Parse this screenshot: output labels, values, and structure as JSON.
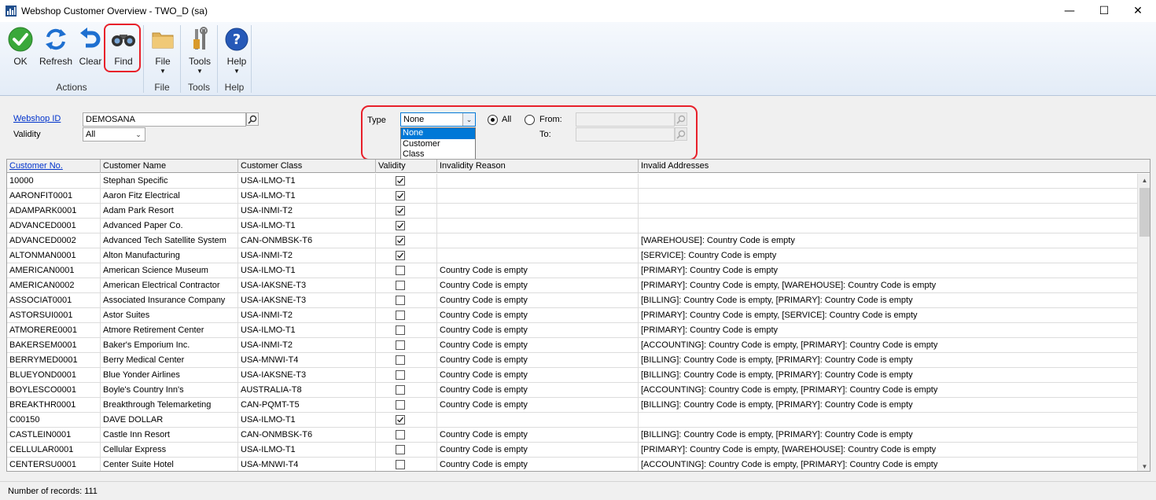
{
  "window": {
    "title": "Webshop Customer Overview  -  TWO_D (sa)",
    "minimize": "—",
    "maximize": "☐",
    "close": "✕"
  },
  "ribbon": {
    "buttons": {
      "ok": "OK",
      "refresh": "Refresh",
      "clear": "Clear",
      "find": "Find",
      "file": "File",
      "tools": "Tools",
      "help": "Help"
    },
    "groups": {
      "actions": "Actions",
      "file": "File",
      "tools": "Tools",
      "help": "Help"
    }
  },
  "form": {
    "webshop_id_label": "Webshop ID",
    "webshop_id_value": "DEMOSANA",
    "validity_label": "Validity",
    "validity_value": "All",
    "type_label": "Type",
    "type_value": "None",
    "type_options": [
      "None",
      "Customer",
      "Class"
    ],
    "all_label": "All",
    "from_label": "From:",
    "to_label": "To:",
    "all_selected": true
  },
  "grid": {
    "headers": [
      "Customer No.",
      "Customer Name",
      "Customer Class",
      "Validity",
      "Invalidity Reason",
      "Invalid Addresses"
    ],
    "rows": [
      {
        "no": "10000",
        "name": "Stephan Specific",
        "cls": "USA-ILMO-T1",
        "valid": true,
        "reason": "",
        "addr": ""
      },
      {
        "no": "AARONFIT0001",
        "name": "Aaron Fitz Electrical",
        "cls": "USA-ILMO-T1",
        "valid": true,
        "reason": "",
        "addr": ""
      },
      {
        "no": "ADAMPARK0001",
        "name": "Adam Park Resort",
        "cls": "USA-INMI-T2",
        "valid": true,
        "reason": "",
        "addr": ""
      },
      {
        "no": "ADVANCED0001",
        "name": "Advanced Paper Co.",
        "cls": "USA-ILMO-T1",
        "valid": true,
        "reason": "",
        "addr": ""
      },
      {
        "no": "ADVANCED0002",
        "name": "Advanced Tech Satellite System",
        "cls": "CAN-ONMBSK-T6",
        "valid": true,
        "reason": "",
        "addr": "[WAREHOUSE]: Country Code is empty"
      },
      {
        "no": "ALTONMAN0001",
        "name": "Alton Manufacturing",
        "cls": "USA-INMI-T2",
        "valid": true,
        "reason": "",
        "addr": "[SERVICE]: Country Code is empty"
      },
      {
        "no": "AMERICAN0001",
        "name": "American Science Museum",
        "cls": "USA-ILMO-T1",
        "valid": false,
        "reason": "Country Code is empty",
        "addr": "[PRIMARY]: Country Code is empty"
      },
      {
        "no": "AMERICAN0002",
        "name": "American Electrical Contractor",
        "cls": "USA-IAKSNE-T3",
        "valid": false,
        "reason": "Country Code is empty",
        "addr": "[PRIMARY]: Country Code is empty, [WAREHOUSE]: Country Code is empty"
      },
      {
        "no": "ASSOCIAT0001",
        "name": "Associated Insurance Company",
        "cls": "USA-IAKSNE-T3",
        "valid": false,
        "reason": "Country Code is empty",
        "addr": "[BILLING]: Country Code is empty, [PRIMARY]: Country Code is empty"
      },
      {
        "no": "ASTORSUI0001",
        "name": "Astor Suites",
        "cls": "USA-INMI-T2",
        "valid": false,
        "reason": "Country Code is empty",
        "addr": "[PRIMARY]: Country Code is empty, [SERVICE]: Country Code is empty"
      },
      {
        "no": "ATMORERE0001",
        "name": "Atmore Retirement Center",
        "cls": "USA-ILMO-T1",
        "valid": false,
        "reason": "Country Code is empty",
        "addr": "[PRIMARY]: Country Code is empty"
      },
      {
        "no": "BAKERSEM0001",
        "name": "Baker's Emporium Inc.",
        "cls": "USA-INMI-T2",
        "valid": false,
        "reason": "Country Code is empty",
        "addr": "[ACCOUNTING]: Country Code is empty, [PRIMARY]: Country Code is empty"
      },
      {
        "no": "BERRYMED0001",
        "name": "Berry Medical Center",
        "cls": "USA-MNWI-T4",
        "valid": false,
        "reason": "Country Code is empty",
        "addr": "[BILLING]: Country Code is empty, [PRIMARY]: Country Code is empty"
      },
      {
        "no": "BLUEYOND0001",
        "name": "Blue Yonder Airlines",
        "cls": "USA-IAKSNE-T3",
        "valid": false,
        "reason": "Country Code is empty",
        "addr": "[BILLING]: Country Code is empty, [PRIMARY]: Country Code is empty"
      },
      {
        "no": "BOYLESCO0001",
        "name": "Boyle's Country Inn's",
        "cls": "AUSTRALIA-T8",
        "valid": false,
        "reason": "Country Code is empty",
        "addr": "[ACCOUNTING]: Country Code is empty, [PRIMARY]: Country Code is empty"
      },
      {
        "no": "BREAKTHR0001",
        "name": "Breakthrough Telemarketing",
        "cls": "CAN-PQMT-T5",
        "valid": false,
        "reason": "Country Code is empty",
        "addr": "[BILLING]: Country Code is empty, [PRIMARY]: Country Code is empty"
      },
      {
        "no": "C00150",
        "name": "DAVE DOLLAR",
        "cls": "USA-ILMO-T1",
        "valid": true,
        "reason": "",
        "addr": ""
      },
      {
        "no": "CASTLEIN0001",
        "name": "Castle Inn Resort",
        "cls": "CAN-ONMBSK-T6",
        "valid": false,
        "reason": "Country Code is empty",
        "addr": "[BILLING]: Country Code is empty, [PRIMARY]: Country Code is empty"
      },
      {
        "no": "CELLULAR0001",
        "name": "Cellular Express",
        "cls": "USA-ILMO-T1",
        "valid": false,
        "reason": "Country Code is empty",
        "addr": "[PRIMARY]: Country Code is empty, [WAREHOUSE]: Country Code is empty"
      },
      {
        "no": "CENTERSU0001",
        "name": "Center Suite Hotel",
        "cls": "USA-MNWI-T4",
        "valid": false,
        "reason": "Country Code is empty",
        "addr": "[ACCOUNTING]: Country Code is empty, [PRIMARY]: Country Code is empty"
      }
    ]
  },
  "status": {
    "records": "Number of records: 111"
  },
  "colors": {
    "highlight": "#e8202a",
    "link": "#0033cc",
    "selection": "#0078d7"
  }
}
